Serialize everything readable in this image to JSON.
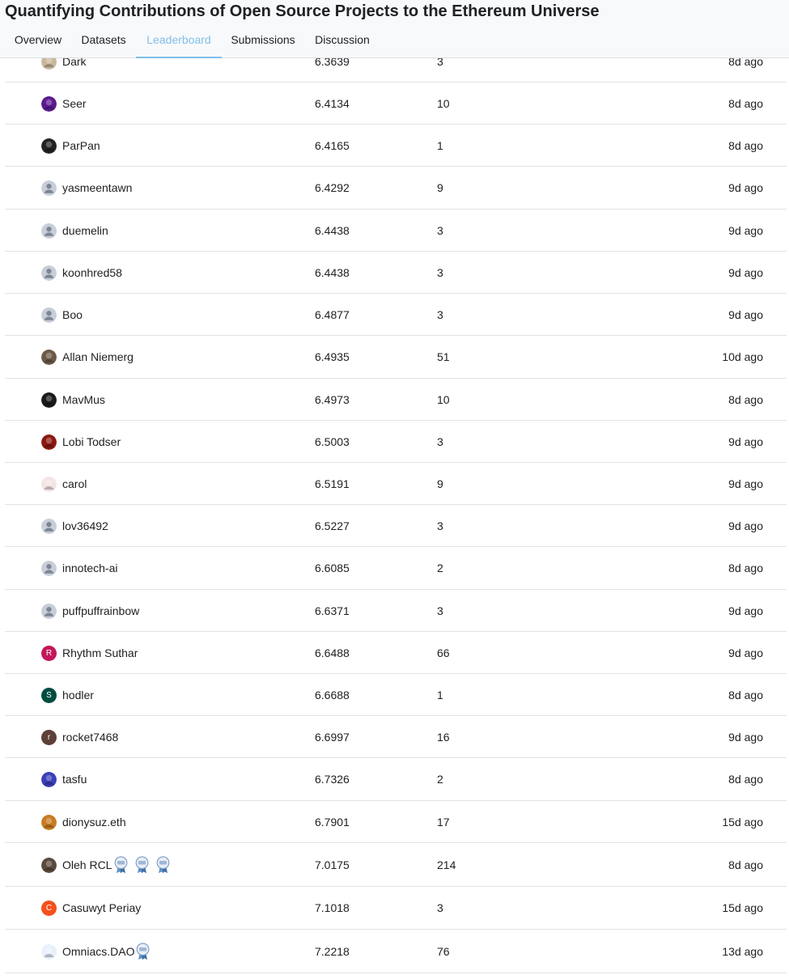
{
  "page": {
    "title": "Quantifying Contributions of Open Source Projects to the Ethereum Universe"
  },
  "tabs": [
    {
      "label": "Overview",
      "active": false
    },
    {
      "label": "Datasets",
      "active": false
    },
    {
      "label": "Leaderboard",
      "active": true
    },
    {
      "label": "Submissions",
      "active": false
    },
    {
      "label": "Discussion",
      "active": false
    }
  ],
  "colors": {
    "accent": "#7fbfe8",
    "header_bg": "#f8f9fa",
    "divider": "#e2e3e5"
  },
  "leaderboard": {
    "rows": [
      {
        "name": "Dark",
        "score": "6.3639",
        "entries": "3",
        "last": "8d ago",
        "avatar": {
          "kind": "photo",
          "color": "#c9b79c",
          "icon": "animal-photo-icon"
        }
      },
      {
        "name": "Seer",
        "score": "6.4134",
        "entries": "10",
        "last": "8d ago",
        "avatar": {
          "kind": "photo",
          "color": "#5b1a8f",
          "icon": "feather-photo-icon"
        }
      },
      {
        "name": "ParPan",
        "score": "6.4165",
        "entries": "1",
        "last": "8d ago",
        "avatar": {
          "kind": "photo",
          "color": "#222222",
          "icon": "dark-photo-icon"
        }
      },
      {
        "name": "yasmeentawn",
        "score": "6.4292",
        "entries": "9",
        "last": "9d ago",
        "avatar": {
          "kind": "default",
          "color": "#c7ced8",
          "icon": "default-user-icon"
        }
      },
      {
        "name": "duemelin",
        "score": "6.4438",
        "entries": "3",
        "last": "9d ago",
        "avatar": {
          "kind": "default",
          "color": "#c7ced8",
          "icon": "default-user-icon"
        }
      },
      {
        "name": "koonhred58",
        "score": "6.4438",
        "entries": "3",
        "last": "9d ago",
        "avatar": {
          "kind": "default",
          "color": "#c7ced8",
          "icon": "default-user-icon"
        }
      },
      {
        "name": "Boo",
        "score": "6.4877",
        "entries": "3",
        "last": "9d ago",
        "avatar": {
          "kind": "default",
          "color": "#c7ced8",
          "icon": "default-user-icon"
        }
      },
      {
        "name": "Allan Niemerg",
        "score": "6.4935",
        "entries": "51",
        "last": "10d ago",
        "avatar": {
          "kind": "photo",
          "color": "#6b5a48",
          "icon": "couple-photo-icon"
        }
      },
      {
        "name": "MavMus",
        "score": "6.4973",
        "entries": "10",
        "last": "8d ago",
        "avatar": {
          "kind": "photo",
          "color": "#1b1b1b",
          "icon": "portrait-photo-icon"
        }
      },
      {
        "name": "Lobi Todser",
        "score": "6.5003",
        "entries": "3",
        "last": "9d ago",
        "avatar": {
          "kind": "photo",
          "color": "#8a1a10",
          "icon": "emblem-photo-icon"
        }
      },
      {
        "name": "carol",
        "score": "6.5191",
        "entries": "9",
        "last": "9d ago",
        "avatar": {
          "kind": "photo",
          "color": "#f4e4e4",
          "icon": "cartoon-photo-icon"
        }
      },
      {
        "name": "lov36492",
        "score": "6.5227",
        "entries": "3",
        "last": "9d ago",
        "avatar": {
          "kind": "default",
          "color": "#c7ced8",
          "icon": "default-user-icon"
        }
      },
      {
        "name": "innotech-ai",
        "score": "6.6085",
        "entries": "2",
        "last": "8d ago",
        "avatar": {
          "kind": "default",
          "color": "#c7ced8",
          "icon": "default-user-icon"
        }
      },
      {
        "name": "puffpuffrainbow",
        "score": "6.6371",
        "entries": "3",
        "last": "9d ago",
        "avatar": {
          "kind": "default",
          "color": "#c7ced8",
          "icon": "default-user-icon"
        }
      },
      {
        "name": "Rhythm Suthar",
        "score": "6.6488",
        "entries": "66",
        "last": "9d ago",
        "avatar": {
          "kind": "letter",
          "color": "#c2185b",
          "letter": "R"
        }
      },
      {
        "name": "hodler",
        "score": "6.6688",
        "entries": "1",
        "last": "8d ago",
        "avatar": {
          "kind": "letter",
          "color": "#004d40",
          "letter": "S"
        }
      },
      {
        "name": "rocket7468",
        "score": "6.6997",
        "entries": "16",
        "last": "9d ago",
        "avatar": {
          "kind": "letter",
          "color": "#5d4037",
          "letter": "r"
        }
      },
      {
        "name": "tasfu",
        "score": "6.7326",
        "entries": "2",
        "last": "8d ago",
        "avatar": {
          "kind": "photo",
          "color": "#3b3fb8",
          "icon": "character-photo-icon"
        }
      },
      {
        "name": "dionysuz.eth",
        "score": "6.7901",
        "entries": "17",
        "last": "15d ago",
        "avatar": {
          "kind": "photo",
          "color": "#c77b22",
          "icon": "statue-photo-icon"
        }
      },
      {
        "name": "Oleh RCL",
        "score": "7.0175",
        "entries": "214",
        "last": "8d ago",
        "avatar": {
          "kind": "photo",
          "color": "#5a4a3c",
          "icon": "pattern-photo-icon"
        },
        "medals": [
          {
            "icon": "competition-medal-icon",
            "label": "x3"
          },
          {
            "icon": "dataset-medal-icon",
            "label": ""
          },
          {
            "icon": "notebook-medal-icon",
            "label": ""
          }
        ]
      },
      {
        "name": "Casuwyt Periay",
        "score": "7.1018",
        "entries": "3",
        "last": "15d ago",
        "avatar": {
          "kind": "letter",
          "color": "#f4511e",
          "letter": "C"
        }
      },
      {
        "name": "Omniacs.DAO",
        "score": "7.2218",
        "entries": "76",
        "last": "13d ago",
        "avatar": {
          "kind": "photo",
          "color": "#e8f1fb",
          "icon": "logo-photo-icon"
        },
        "medals": [
          {
            "icon": "dataset-medal-icon",
            "label": ""
          }
        ]
      }
    ]
  }
}
